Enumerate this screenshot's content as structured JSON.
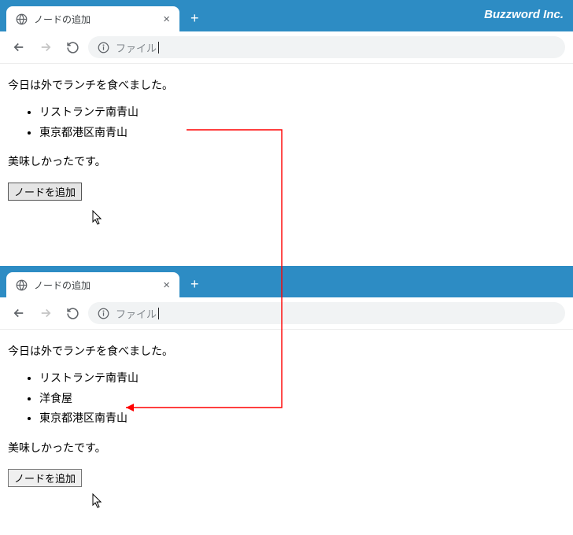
{
  "brand": "Buzzword Inc.",
  "browsers": [
    {
      "tab": {
        "title": "ノードの追加"
      },
      "address": {
        "text": "ファイル"
      },
      "page": {
        "before_text": "今日は外でランチを食べました。",
        "list_items": [
          "リストランテ南青山",
          "東京都港区南青山"
        ],
        "after_text": "美味しかったです。",
        "button_label": "ノードを追加"
      }
    },
    {
      "tab": {
        "title": "ノードの追加"
      },
      "address": {
        "text": "ファイル"
      },
      "page": {
        "before_text": "今日は外でランチを食べました。",
        "list_items": [
          "リストランテ南青山",
          "洋食屋",
          "東京都港区南青山"
        ],
        "after_text": "美味しかったです。",
        "button_label": "ノードを追加"
      }
    }
  ]
}
